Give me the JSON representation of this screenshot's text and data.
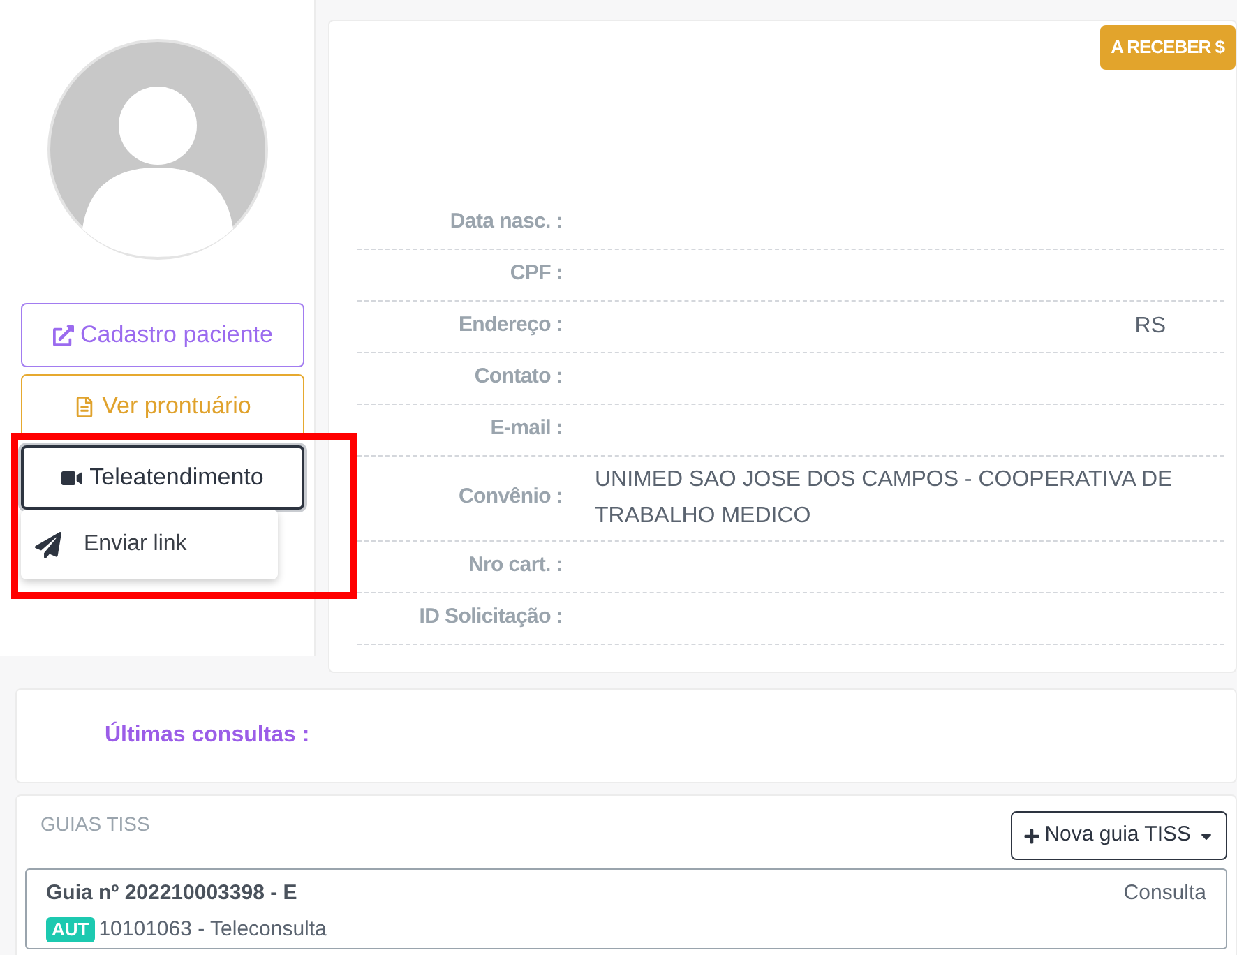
{
  "sidebar": {
    "buttons": [
      {
        "kind": "external",
        "label": "Cadastro paciente"
      },
      {
        "kind": "document",
        "label": "Ver prontuário"
      },
      {
        "kind": "video",
        "label": "Teleatendimento",
        "expanded": true
      }
    ],
    "dropdown": [
      {
        "label": "Enviar link"
      }
    ]
  },
  "badge": "A RECEBER $",
  "fields": [
    {
      "label": "Data nasc. :"
    },
    {
      "label": "CPF :"
    },
    {
      "label": "Endereço :",
      "kind": "partial",
      "value": "RS"
    },
    {
      "label": "Contato :"
    },
    {
      "label": "E-mail :"
    },
    {
      "label": "Convênio :",
      "kind": "text",
      "value": "UNIMED SAO JOSE DOS CAMPOS - COOPERATIVA DE TRABALHO MEDICO"
    },
    {
      "label": "Nro cart. :"
    },
    {
      "label": "ID Solicitação :"
    }
  ],
  "recent": {
    "label": "Últimas consultas :"
  },
  "guias": {
    "title": "GUIAS TISS",
    "new_button": "Nova guia TISS",
    "items": [
      {
        "title": "Guia nº 202210003398 - E",
        "type": "Consulta",
        "status": "AUT",
        "procedure": "10101063 - Teleconsulta"
      }
    ]
  }
}
